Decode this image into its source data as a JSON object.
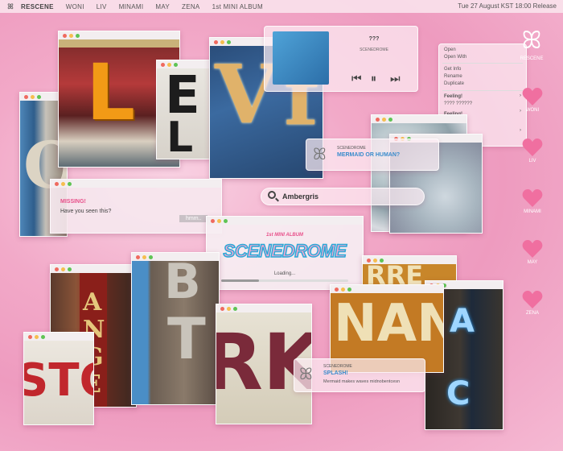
{
  "menubar": {
    "logo": "ꕤ",
    "items": [
      "RESCENE",
      "WONI",
      "LIV",
      "MINAMI",
      "MAY",
      "ZENA",
      "1st MINI ALBUM"
    ],
    "clock": "Tue 27 August KST 18:00 Release"
  },
  "music_player": {
    "title": "???",
    "artist": "SCENEDROME"
  },
  "context_menu": {
    "items": [
      "Open",
      "Open With",
      "Get Info",
      "Rename",
      "Duplicate",
      "Feeling!",
      "???? ??????",
      "Feeling!",
      "????"
    ]
  },
  "notification_1": {
    "app": "SCENEDROME",
    "title": "MERMAID OR HUMAN?"
  },
  "search": {
    "value": "Ambergris"
  },
  "message_window": {
    "title": "MISSING!",
    "body": "Have you seen this?",
    "reply": "hmm.."
  },
  "loading_window": {
    "album_line": "1st MINI ALBUM",
    "album_name": "SCENEDROME",
    "status": "Loading..."
  },
  "notification_2": {
    "app": "SCENEDROME",
    "title": "SPLASH!",
    "body": "Mermaid makes waves midnobentcesn"
  },
  "sidebar": {
    "logo_label": "RESCENE",
    "members": [
      "WONI",
      "LIV",
      "MINAMI",
      "MAY",
      "ZENA"
    ]
  },
  "photo_letters": {
    "l_sign": "L",
    "e_sign": "E",
    "v_sign": "V",
    "f_sign": "f",
    "o_sign": "O",
    "ange_a": "A",
    "ange_n": "N",
    "ange_g": "G",
    "ange_e": "E",
    "st_sign": "STO",
    "bt_b": "B",
    "bt_t": "T",
    "rk_sign": "RK",
    "nan_sign": "NAN",
    "rre_sign": "RRE",
    "neon_a": "A",
    "neon_c": "C",
    "l_small": "L"
  },
  "colors": {
    "accent_pink": "#e8508a",
    "heart_pink": "#f06fa0",
    "notification_blue": "#3a8ccc"
  }
}
